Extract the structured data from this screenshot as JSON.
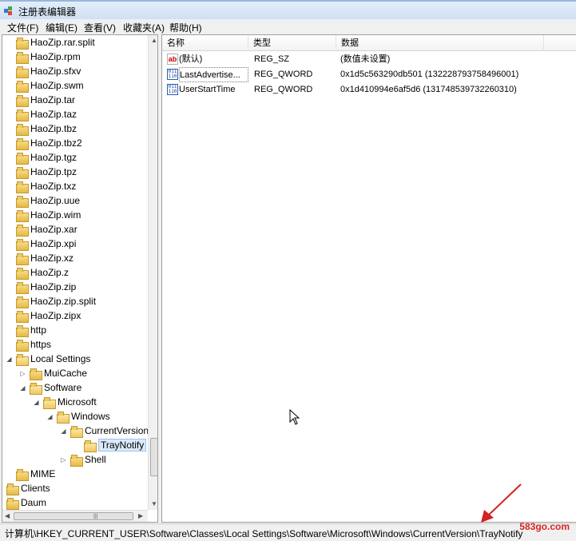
{
  "window": {
    "title": "注册表编辑器"
  },
  "menu": [
    "文件(F)",
    "编辑(E)",
    "查看(V)",
    "收藏夹(A)",
    "帮助(H)"
  ],
  "tree": [
    {
      "label": "HaoZip.rar.split",
      "indent": 0,
      "arrow": ""
    },
    {
      "label": "HaoZip.rpm",
      "indent": 0,
      "arrow": ""
    },
    {
      "label": "HaoZip.sfxv",
      "indent": 0,
      "arrow": ""
    },
    {
      "label": "HaoZip.swm",
      "indent": 0,
      "arrow": ""
    },
    {
      "label": "HaoZip.tar",
      "indent": 0,
      "arrow": ""
    },
    {
      "label": "HaoZip.taz",
      "indent": 0,
      "arrow": ""
    },
    {
      "label": "HaoZip.tbz",
      "indent": 0,
      "arrow": ""
    },
    {
      "label": "HaoZip.tbz2",
      "indent": 0,
      "arrow": ""
    },
    {
      "label": "HaoZip.tgz",
      "indent": 0,
      "arrow": ""
    },
    {
      "label": "HaoZip.tpz",
      "indent": 0,
      "arrow": ""
    },
    {
      "label": "HaoZip.txz",
      "indent": 0,
      "arrow": ""
    },
    {
      "label": "HaoZip.uue",
      "indent": 0,
      "arrow": ""
    },
    {
      "label": "HaoZip.wim",
      "indent": 0,
      "arrow": ""
    },
    {
      "label": "HaoZip.xar",
      "indent": 0,
      "arrow": ""
    },
    {
      "label": "HaoZip.xpi",
      "indent": 0,
      "arrow": ""
    },
    {
      "label": "HaoZip.xz",
      "indent": 0,
      "arrow": ""
    },
    {
      "label": "HaoZip.z",
      "indent": 0,
      "arrow": ""
    },
    {
      "label": "HaoZip.zip",
      "indent": 0,
      "arrow": ""
    },
    {
      "label": "HaoZip.zip.split",
      "indent": 0,
      "arrow": ""
    },
    {
      "label": "HaoZip.zipx",
      "indent": 0,
      "arrow": ""
    },
    {
      "label": "http",
      "indent": 0,
      "arrow": ""
    },
    {
      "label": "https",
      "indent": 0,
      "arrow": ""
    },
    {
      "label": "Local Settings",
      "indent": 0,
      "arrow": "expanded"
    },
    {
      "label": "MuiCache",
      "indent": 1,
      "arrow": "collapsed"
    },
    {
      "label": "Software",
      "indent": 1,
      "arrow": "expanded"
    },
    {
      "label": "Microsoft",
      "indent": 2,
      "arrow": "expanded"
    },
    {
      "label": "Windows",
      "indent": 3,
      "arrow": "expanded"
    },
    {
      "label": "CurrentVersion",
      "indent": 4,
      "arrow": "expanded"
    },
    {
      "label": "TrayNotify",
      "indent": 5,
      "arrow": "",
      "selected": true
    },
    {
      "label": "Shell",
      "indent": 4,
      "arrow": "collapsed"
    },
    {
      "label": "MIME",
      "indent": 0,
      "arrow": ""
    },
    {
      "label": "Clients",
      "indent": -1,
      "arrow": ""
    },
    {
      "label": "Daum",
      "indent": -1,
      "arrow": ""
    }
  ],
  "list": {
    "columns": [
      "名称",
      "类型",
      "数据"
    ],
    "rows": [
      {
        "icon": "string-value-icon",
        "name": "(默认)",
        "type": "REG_SZ",
        "data": "(数值未设置)"
      },
      {
        "icon": "binary-value-icon",
        "name": "LastAdvertise...",
        "type": "REG_QWORD",
        "data": "0x1d5c563290db501 (132228793758496001)"
      },
      {
        "icon": "binary-value-icon",
        "name": "UserStartTime",
        "type": "REG_QWORD",
        "data": "0x1d410994e6af5d6 (131748539732260310)"
      }
    ]
  },
  "status": {
    "path": "计算机\\HKEY_CURRENT_USER\\Software\\Classes\\Local Settings\\Software\\Microsoft\\Windows\\CurrentVersion\\TrayNotify"
  },
  "watermark": "583go.com",
  "colors": {
    "accent": "#d22222",
    "selection": "#dbe9f9"
  }
}
